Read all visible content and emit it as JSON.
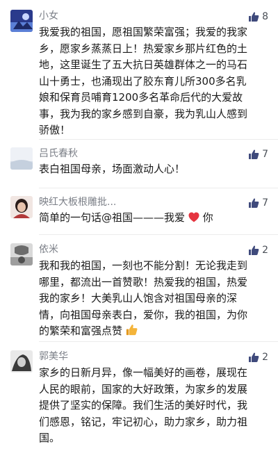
{
  "comments": [
    {
      "name": "小女",
      "likes": "8",
      "lines": [
        "我爱我的祖国，愿祖国繁荣富强；我爱的我家",
        "乡，愿家乡蒸蒸日上！热爱家乡那片红色的土",
        "地，这里诞生了五大抗日英雄群体之一的马石",
        "山十勇士，也涌现出了胶东育儿所300多名乳",
        "娘和保育员哺育1200多名革命后代的大爱故",
        "事，我为我的家乡感到自豪，我为乳山人感到",
        "骄傲！"
      ]
    },
    {
      "name": "吕氏春秋",
      "likes": "7",
      "lines": [
        "表白祖国母亲，场面激动人心！"
      ]
    },
    {
      "name": "映红大板根雕批...",
      "likes": "7",
      "text_before": "简单的一句话@祖国———我爱",
      "text_after": "你"
    },
    {
      "name": "依米",
      "likes": "2",
      "lines": [
        "我和我的祖国，一刻也不能分割！无论我走到",
        "哪里，都流出一首赞歌！热爱我的祖国，热爱",
        "我的家乡！大美乳山人饱含对祖国母亲的深",
        "情，向祖国母亲表白，爱你，我的祖国，为你"
      ],
      "last_line": "的繁荣和富强点赞"
    },
    {
      "name": "郭美华",
      "likes": "2",
      "lines": [
        "家乡的日新月异，像一幅美好的画卷，展现在",
        "人民的眼前，国家的大好政策，为家乡的发展",
        "提供了坚实的保障。我们生活的美好时代，我",
        "们感恩，铭记，牢记初心，助力家乡，助力祖",
        "国。"
      ]
    }
  ],
  "icons": {
    "like": "thumbs-up-icon",
    "heart": "red-heart-emoji",
    "thumbs_up_emoji": "thumbs-up-emoji"
  },
  "colors": {
    "name": "#7b7f87",
    "text": "#1a1a1a",
    "like_icon": "#3f4a7c",
    "heart": "#e5343f",
    "emoji_thumb": "#f4b43a"
  }
}
